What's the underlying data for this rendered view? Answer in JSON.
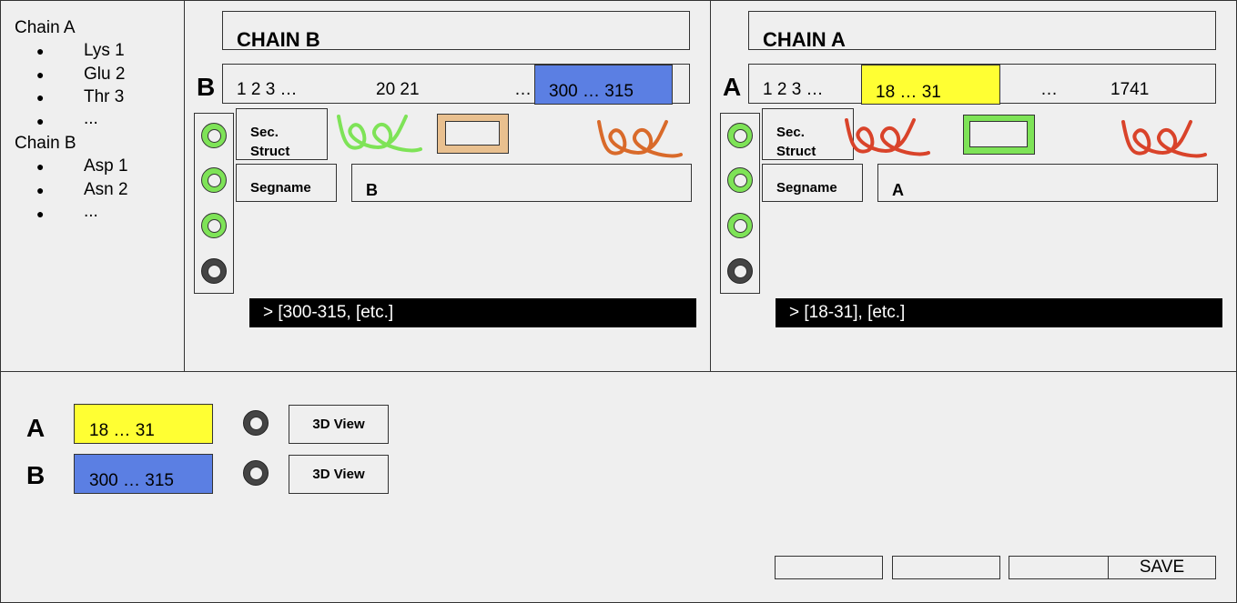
{
  "chain_list": {
    "groups": [
      {
        "title": "Chain A",
        "items": [
          "Lys 1",
          "Glu 2",
          "Thr 3",
          "..."
        ]
      },
      {
        "title": "Chain B",
        "items": [
          "Asp 1",
          "Asn 2",
          "..."
        ]
      }
    ],
    "bullet": "●"
  },
  "panel_b": {
    "title": "CHAIN B",
    "letter": "B",
    "seq_start": "1 2 3 …",
    "seq_mid": "20 21",
    "seq_ellipsis": "…",
    "seq_highlight": "300 … 315",
    "sec_struct_label": "Sec.\nStruct",
    "segname_label": "Segname",
    "segname_value": "B",
    "console": "> [300-315, [etc.]",
    "colors": {
      "highlight": "#5b7fe3",
      "helix_1": "#7ee357",
      "strand": "#e9c08f",
      "helix_2": "#d96a2a"
    }
  },
  "panel_a": {
    "title": "CHAIN A",
    "letter": "A",
    "seq_start": "1 2 3 …",
    "seq_highlight": "18 … 31",
    "seq_ellipsis": "…",
    "seq_end": "1741",
    "sec_struct_label": "Sec.\nStruct",
    "segname_label": "Segname",
    "segname_value": "A",
    "console": "> [18-31], [etc.]",
    "colors": {
      "highlight": "#ffff33",
      "helix_1": "#d9432a",
      "strand": "#7ee357",
      "helix_2": "#d9432a"
    }
  },
  "selections": [
    {
      "chain": "A",
      "range": "18 … 31",
      "color": "#ffff33",
      "button": "3D View"
    },
    {
      "chain": "B",
      "range": "300 … 315",
      "color": "#5b7fe3",
      "button": "3D View"
    }
  ],
  "footer": {
    "buttons": [
      "",
      "",
      "",
      "SAVE"
    ]
  }
}
